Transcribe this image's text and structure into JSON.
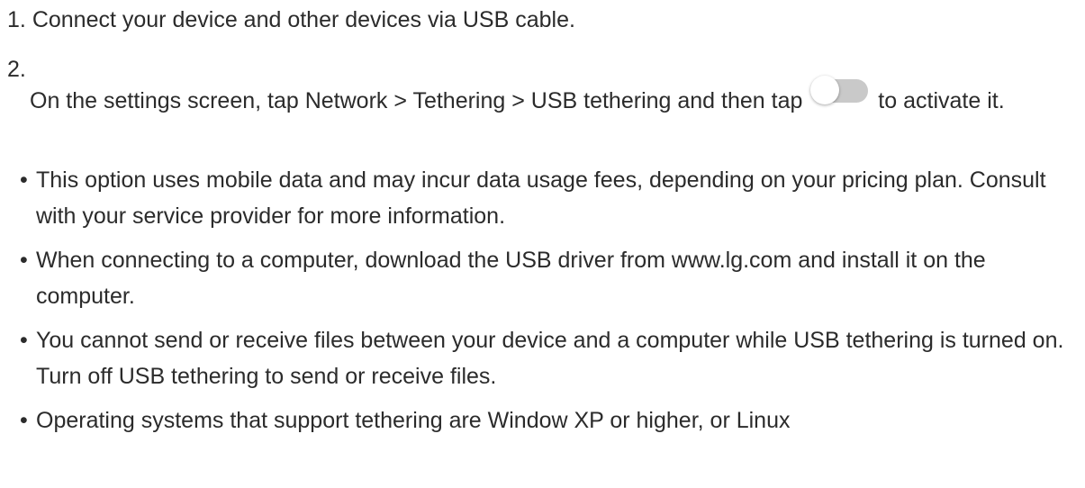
{
  "steps": [
    {
      "number": "1.",
      "text": "Connect your device and other devices via USB cable."
    },
    {
      "number": "2.",
      "text_before": "On the settings screen, tap Network > Tethering > USB tethering and then tap",
      "text_after": "to activate it.",
      "toggle_icon": "toggle-switch-off-icon"
    }
  ],
  "bullet_symbol": "•",
  "notes": [
    "This option uses mobile data and may incur data usage fees, depending on your pricing plan. Consult with your service provider for more information.",
    "When connecting to a computer, download the USB driver from www.lg.com and install it on the computer.",
    "You cannot send or receive files between your device and a computer while USB tethering is turned on. Turn off USB tethering to send or receive files.",
    "Operating systems that support tethering are Window XP or higher, or Linux"
  ],
  "colors": {
    "text": "#2b2b2b",
    "toggle_track": "#c9c9c9",
    "toggle_knob": "#ffffff"
  }
}
